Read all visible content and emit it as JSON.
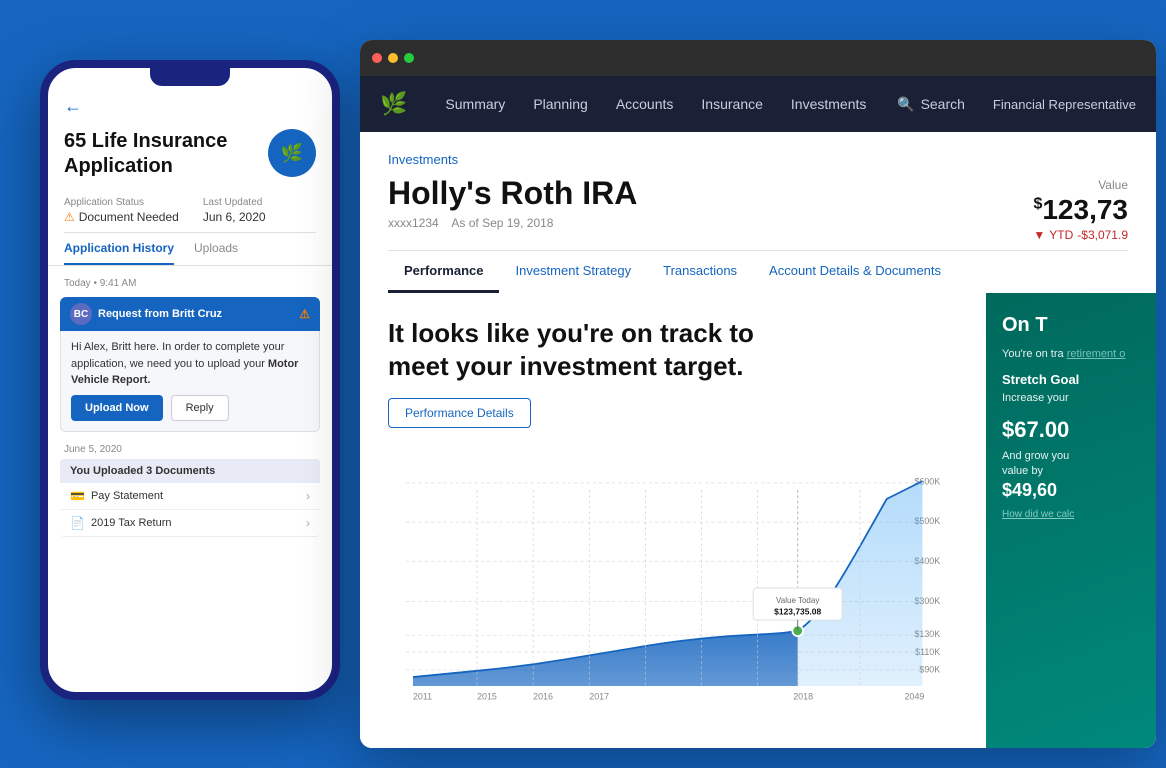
{
  "background_color": "#1565c0",
  "phone": {
    "header": {
      "back_label": "←",
      "title": "65 Life Insurance Application",
      "avatar_symbol": "🌿"
    },
    "status": {
      "application_status_label": "Application Status",
      "application_status_value": "Document Needed",
      "last_updated_label": "Last Updated",
      "last_updated_value": "Jun 6, 2020"
    },
    "tabs": [
      {
        "label": "Application History",
        "active": true
      },
      {
        "label": "Uploads",
        "active": false
      }
    ],
    "history": {
      "today_label": "Today • 9:41 AM",
      "sender_label": "Request from Britt Cruz",
      "warn_symbol": "⚠",
      "message": "Hi Alex, Britt here. In order to complete your application, we need you to upload your",
      "message_bold": "Motor Vehicle Report.",
      "upload_btn": "Upload Now",
      "reply_btn": "Reply"
    },
    "uploads": {
      "section_date": "June 5, 2020",
      "upload_header": "You Uploaded 3 Documents",
      "docs": [
        {
          "icon": "💳",
          "label": "Pay Statement"
        },
        {
          "icon": "📄",
          "label": "2019 Tax Return"
        }
      ]
    }
  },
  "browser": {
    "chrome_dots": [
      "red",
      "yellow",
      "green"
    ],
    "nav": {
      "logo_symbol": "🌿",
      "items": [
        {
          "label": "Summary",
          "active": false
        },
        {
          "label": "Planning",
          "active": false
        },
        {
          "label": "Accounts",
          "active": false
        },
        {
          "label": "Insurance",
          "active": false
        },
        {
          "label": "Investments",
          "active": false
        }
      ],
      "search_label": "Search",
      "search_icon": "🔍",
      "rep_label": "Financial Representative"
    },
    "account": {
      "breadcrumb": "Investments",
      "title": "Holly's Roth IRA",
      "account_number": "xxxx1234",
      "as_of": "As of Sep 19, 2018",
      "value_label": "Value",
      "value_prefix": "$",
      "value_amount": "123,73",
      "ytd_label": "YTD",
      "ytd_value": "-$3,071.9",
      "tabs": [
        {
          "label": "Performance",
          "active": true
        },
        {
          "label": "Investment Strategy",
          "active": false,
          "link": true
        },
        {
          "label": "Transactions",
          "active": false,
          "link": true
        },
        {
          "label": "Account Details & Documents",
          "active": false,
          "link": true
        }
      ]
    },
    "chart": {
      "headline": "It looks like you're on track to meet your investment target.",
      "perf_details_btn": "Performance Details",
      "tooltip_label": "Value Today",
      "tooltip_value": "$123,735.08",
      "y_labels": [
        "$600K",
        "$500K",
        "$400K",
        "$300K",
        "$130K",
        "$110K",
        "$90K"
      ],
      "x_labels": [
        "2011",
        "2015",
        "2018",
        "2049"
      ],
      "dot_year": "2018"
    },
    "on_track": {
      "title": "On T",
      "body_text": "You're on tra retirement o",
      "link_text": "retirement o",
      "stretch_goal_label": "Stretch Goal",
      "stretch_intro": "Increase your",
      "stretch_amount": "$67.00",
      "grow_text": "And grow you value by",
      "grow_amount": "$49,60",
      "how_calc": "How did we calc",
      "btn_label": ""
    }
  }
}
